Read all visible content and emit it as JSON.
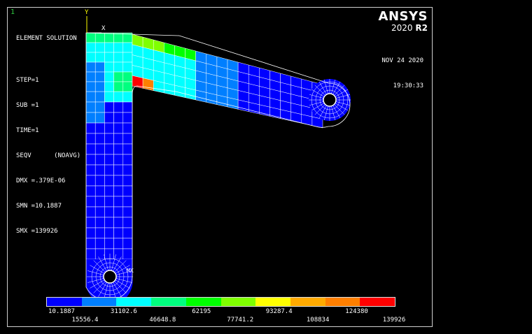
{
  "window_number": "1",
  "info": {
    "lines": [
      "ELEMENT SOLUTION",
      "",
      "STEP=1",
      "SUB =1",
      "TIME=1",
      "SEQV      (NOAVG)",
      "DMX =.379E-06",
      "SMN =10.1887",
      "SMX =139926"
    ]
  },
  "brand": {
    "name": "ANSYS",
    "version_year": "2020",
    "version_rel": "R2"
  },
  "datetime": {
    "date": "NOV 24 2020",
    "time": "19:30:33"
  },
  "triad": {
    "y_label": "Y",
    "x_label": "X"
  },
  "node_label": "MX",
  "legend": {
    "colors": [
      "#0000ff",
      "#007fff",
      "#00ffff",
      "#00ff7f",
      "#00ff00",
      "#7fff00",
      "#ffff00",
      "#ffaa00",
      "#ff7f00",
      "#ff0000"
    ],
    "top_labels": [
      "10.1887",
      "31102.6",
      "62195",
      "93287.4",
      "124380"
    ],
    "bottom_labels": [
      "15556.4",
      "46648.8",
      "77741.2",
      "108834",
      "139926"
    ]
  }
}
